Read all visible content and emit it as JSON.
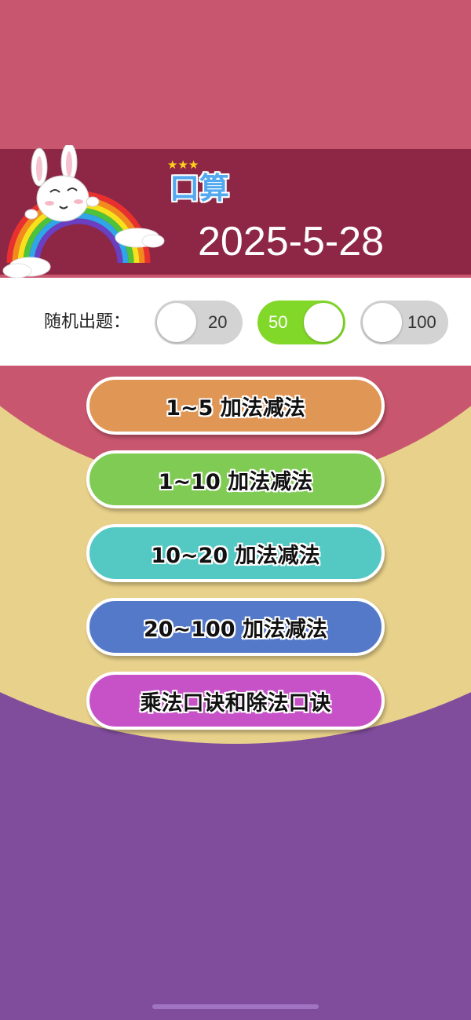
{
  "colors": {
    "top_band": "#c9566f",
    "header_bg": "#8d2745",
    "yellow_arc": "#e8d18a",
    "purple_bottom": "#804d9d",
    "toggle_on": "#82d829",
    "toggle_off": "#d3d3d3"
  },
  "header": {
    "stars": "★★★",
    "title": "口算",
    "date": "2025-5-28",
    "mascot_icon": "rabbit-rainbow-icon"
  },
  "random": {
    "label": "随机出题：",
    "options": [
      {
        "label": "20",
        "on": false
      },
      {
        "label": "50",
        "on": true
      },
      {
        "label": "100",
        "on": false
      }
    ]
  },
  "menu": [
    {
      "label": "1~5 加法减法",
      "color": "#e09655"
    },
    {
      "label": "1~10 加法减法",
      "color": "#7fcb54"
    },
    {
      "label": "10~20 加法减法",
      "color": "#54c9c4"
    },
    {
      "label": "20~100 加法减法",
      "color": "#5479c9"
    },
    {
      "label": "乘法口诀和除法口诀",
      "color": "#c752c8"
    }
  ]
}
